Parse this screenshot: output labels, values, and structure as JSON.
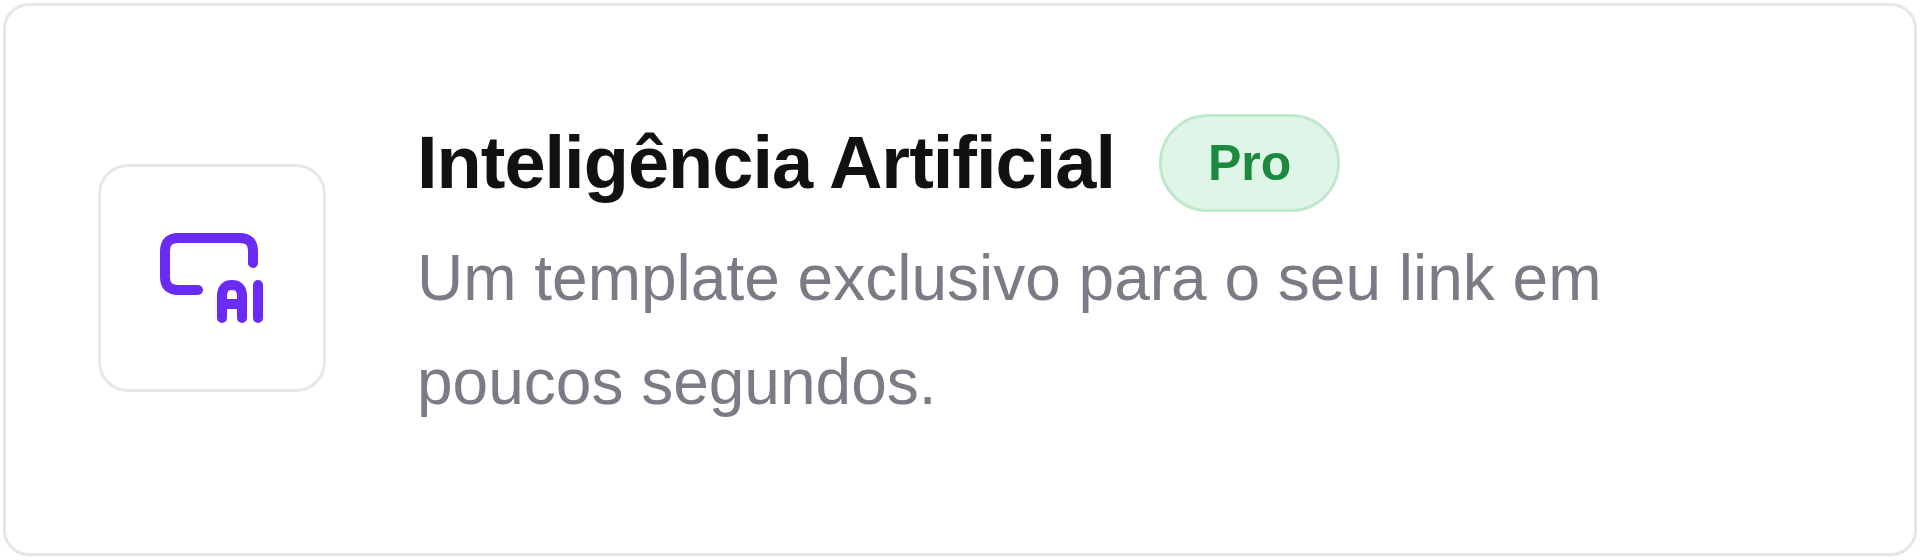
{
  "card": {
    "title": "Inteligência Artificial",
    "badge": "Pro",
    "description": "Um template exclusivo para o seu link em poucos segundos."
  }
}
